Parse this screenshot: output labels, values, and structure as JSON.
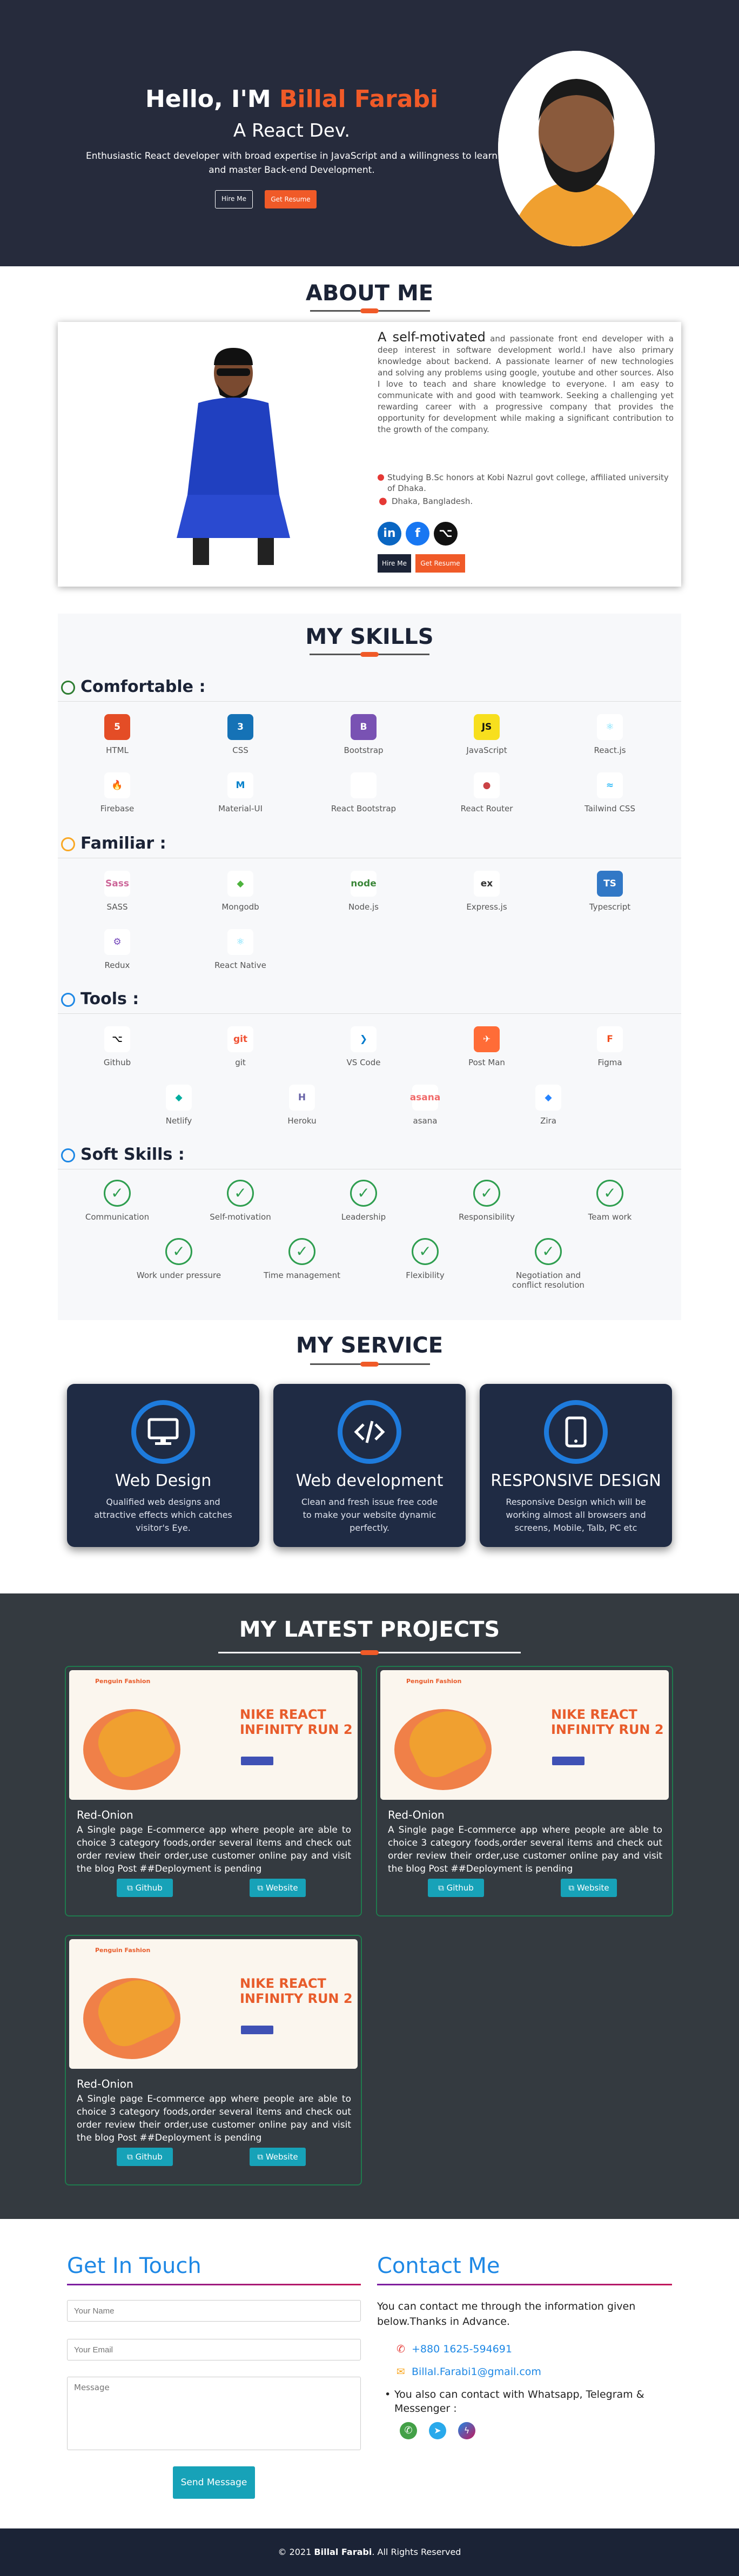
{
  "hero": {
    "greeting": "Hello, I'M",
    "name": "Billal Farabi",
    "role": "A React Dev.",
    "description": "Enthusiastic React developer with broad expertise in JavaScript and a willingness to learn and master Back-end Development.",
    "hire_label": "Hire Me",
    "resume_label": "Get Resume"
  },
  "about": {
    "heading": "ABOUT ME",
    "lead": "A self-motivated",
    "text": "and passionate front end developer with a deep interest in software development world.I have also primary knowledge about backend. A passionate learner of new technologies and solving any problems using google, youtube and other sources. Also I love to teach and share knowledge to everyone. I am easy to communicate with and good with teamwork. Seeking a challenging yet rewarding career with a progressive company that provides the opportunity for development while making a significant contribution to the growth of the company.",
    "study": "Studying B.Sc honors at Kobi Nazrul govt college, affiliated university of Dhaka.",
    "location": "Dhaka, Bangladesh.",
    "hire_label": "Hire Me",
    "resume_label": "Get Resume"
  },
  "skills": {
    "heading": "MY SKILLS",
    "comfortable": {
      "title": "Comfortable :",
      "items": [
        "HTML",
        "CSS",
        "Bootstrap",
        "JavaScript",
        "React.js",
        "Firebase",
        "Material-UI",
        "React Bootstrap",
        "React Router",
        "Tailwind CSS"
      ],
      "alt": "react-bootstrap"
    },
    "familiar": {
      "title": "Familiar :",
      "items": [
        "SASS",
        "Mongodb",
        "Node.js",
        "Express.js",
        "Typescript",
        "Redux",
        "React Native"
      ]
    },
    "tools": {
      "title": "Tools :",
      "items": [
        "Github",
        "git",
        "VS Code",
        "Post Man",
        "Figma",
        "Netlify",
        "Heroku",
        "asana",
        "Zira"
      ]
    },
    "soft": {
      "title": "Soft Skills :",
      "items": [
        "Communication",
        "Self-motivation",
        "Leadership",
        "Responsibility",
        "Team work",
        "Work under pressure",
        "Time management",
        "Flexibility",
        "Negotiation and conflict resolution"
      ]
    }
  },
  "service": {
    "heading": "MY SERVICE",
    "items": [
      {
        "title": "Web Design",
        "text": "Qualified web designs and attractive effects which catches visitor's Eye."
      },
      {
        "title": "Web development",
        "text": "Clean and fresh issue free code to make your website dynamic perfectly."
      },
      {
        "title": "RESPONSIVE DESIGN",
        "text": "Responsive Design which will be working almost all browsers and screens, Mobile, Talb, PC etc"
      }
    ]
  },
  "projects": {
    "heading": "MY LATEST PROJECTS",
    "shot": {
      "brand": "Penguin Fashion",
      "headline1": "NIKE REACT",
      "headline2": "INFINITY RUN 2"
    },
    "items": [
      {
        "title": "Red-Onion",
        "desc": "A Single page E-commerce app where people are able to choice 3 category foods,order several items and check out order review their order,use customer online pay and visit the blog Post ##Deployment is pending",
        "github": "Github",
        "website": "Website"
      },
      {
        "title": "Red-Onion",
        "desc": "A Single page E-commerce app where people are able to choice 3 category foods,order several items and check out order review their order,use customer online pay and visit the blog Post ##Deployment is pending",
        "github": "Github",
        "website": "Website"
      },
      {
        "title": "Red-Onion",
        "desc": "A Single page E-commerce app where people are able to choice 3 category foods,order several items and check out order review their order,use customer online pay and visit the blog Post ##Deployment is pending",
        "github": "Github",
        "website": "Website"
      }
    ]
  },
  "contact": {
    "touch_heading": "Get In Touch",
    "name_placeholder": "Your Name",
    "email_placeholder": "Your Email",
    "message_placeholder": "Message",
    "send_label": "Send Message",
    "me_heading": "Contact Me",
    "intro": "You can contact me through the information given below.Thanks in Advance.",
    "phone": "+880 1625-594691",
    "email": "Billal.Farabi1@gmail.com",
    "also": "You also can contact with Whatsapp, Telegram & Messenger :"
  },
  "footer": {
    "prefix": "© 2021",
    "name": "Billal Farabi",
    "suffix": ". All Rights Reserved"
  },
  "colors": {
    "accent": "#f05a28",
    "navy": "#262b3c",
    "blue": "#1e88e5",
    "teal": "#17a2b8"
  }
}
